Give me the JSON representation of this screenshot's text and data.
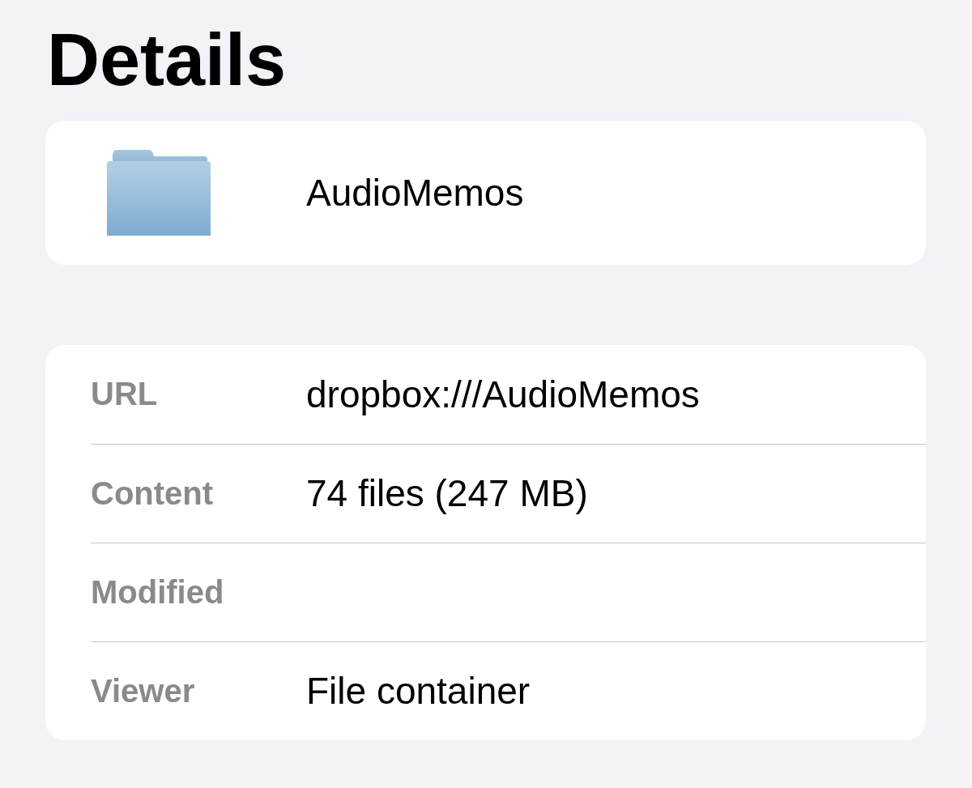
{
  "title": "Details",
  "item": {
    "name": "AudioMemos"
  },
  "details": [
    {
      "label": "URL",
      "value": "dropbox:///AudioMemos"
    },
    {
      "label": "Content",
      "value": "74 files (247 MB)"
    },
    {
      "label": "Modified"
    },
    {
      "label": "Viewer",
      "value": "File container"
    }
  ]
}
